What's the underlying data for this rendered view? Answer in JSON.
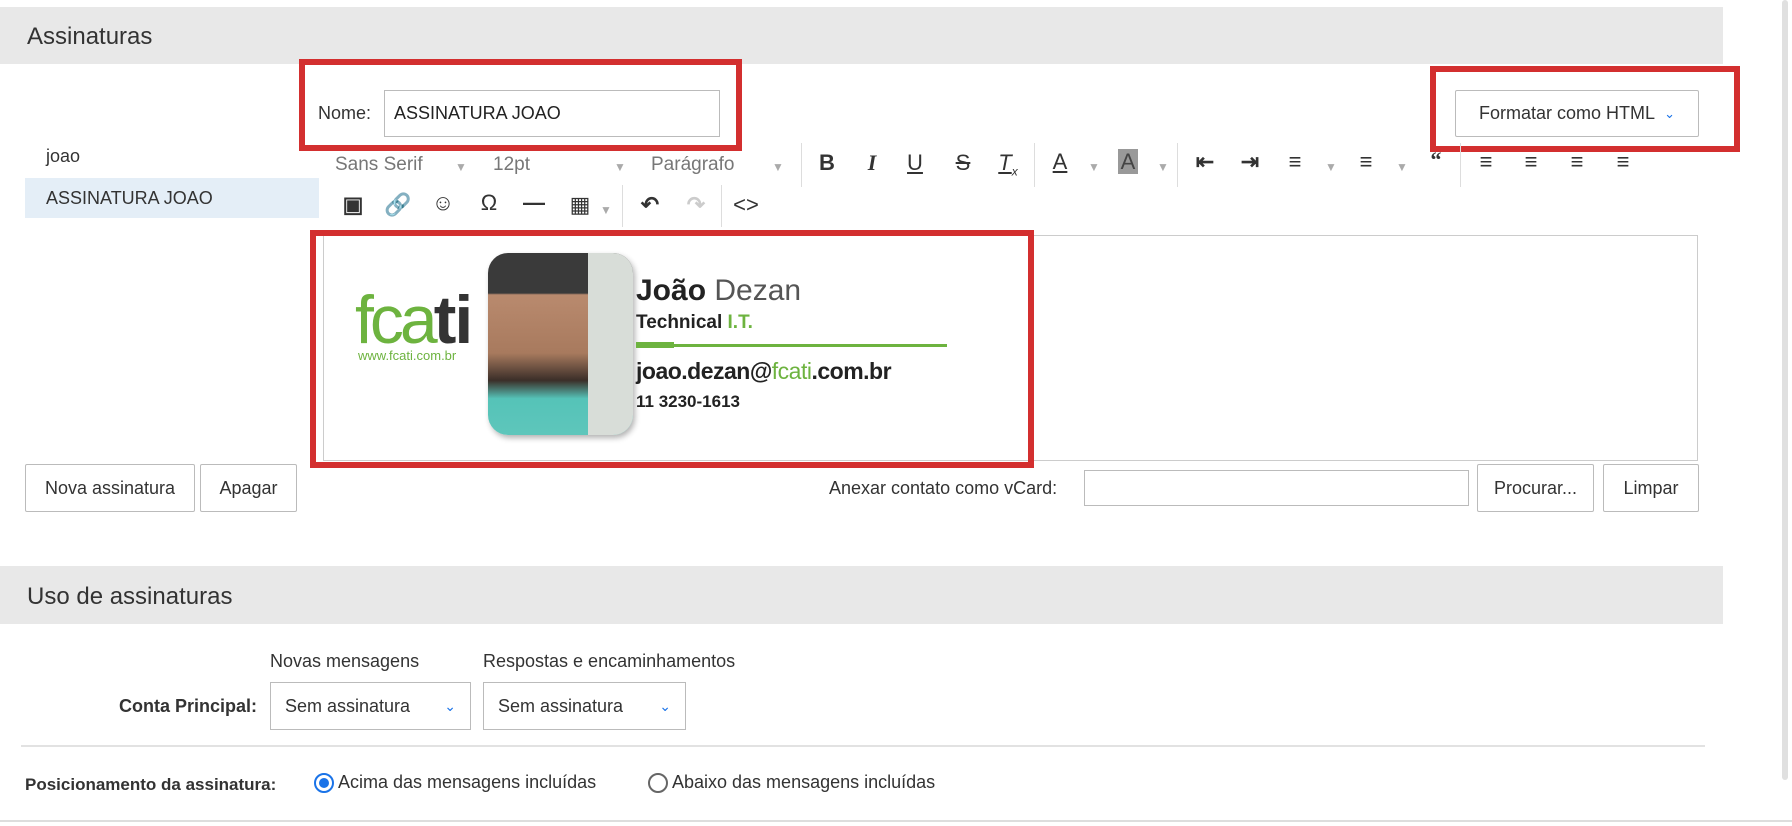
{
  "signatures": {
    "title": "Assinaturas",
    "list": [
      {
        "label": "joao"
      },
      {
        "label": "ASSINATURA JOAO"
      }
    ],
    "name_label": "Nome:",
    "name_value": "ASSINATURA JOAO",
    "format_button": "Formatar como HTML",
    "toolbar": {
      "font": "Sans Serif",
      "size": "12pt",
      "paragraph": "Parágrafo"
    },
    "card": {
      "logo_text_a": "fca",
      "logo_text_b": "ti",
      "logo_url": "www.fcati.com.br",
      "first_name": "João",
      "last_name": "Dezan",
      "role_a": "Technical",
      "role_b": "I.T.",
      "email_a": "joao.dezan@",
      "email_b": "fcati",
      "email_c": ".com.br",
      "phone": "11 3230-1613"
    },
    "new_button": "Nova assinatura",
    "delete_button": "Apagar",
    "vcard_label": "Anexar contato como vCard:",
    "vcard_value": "",
    "browse_button": "Procurar...",
    "clear_button": "Limpar"
  },
  "usage": {
    "title": "Uso de assinaturas",
    "col_new": "Novas mensagens",
    "col_reply": "Respostas e encaminhamentos",
    "account_label": "Conta Principal:",
    "new_select": "Sem assinatura",
    "reply_select": "Sem assinatura",
    "position_label": "Posicionamento da assinatura:",
    "option_above": "Acima das mensagens incluídas",
    "option_below": "Abaixo das mensagens incluídas",
    "selected_option": "above"
  },
  "colors": {
    "highlight": "#d32f2f",
    "accent": "#1a73e8",
    "brand_green": "#6db33f",
    "selected_row": "#e4eef7"
  }
}
